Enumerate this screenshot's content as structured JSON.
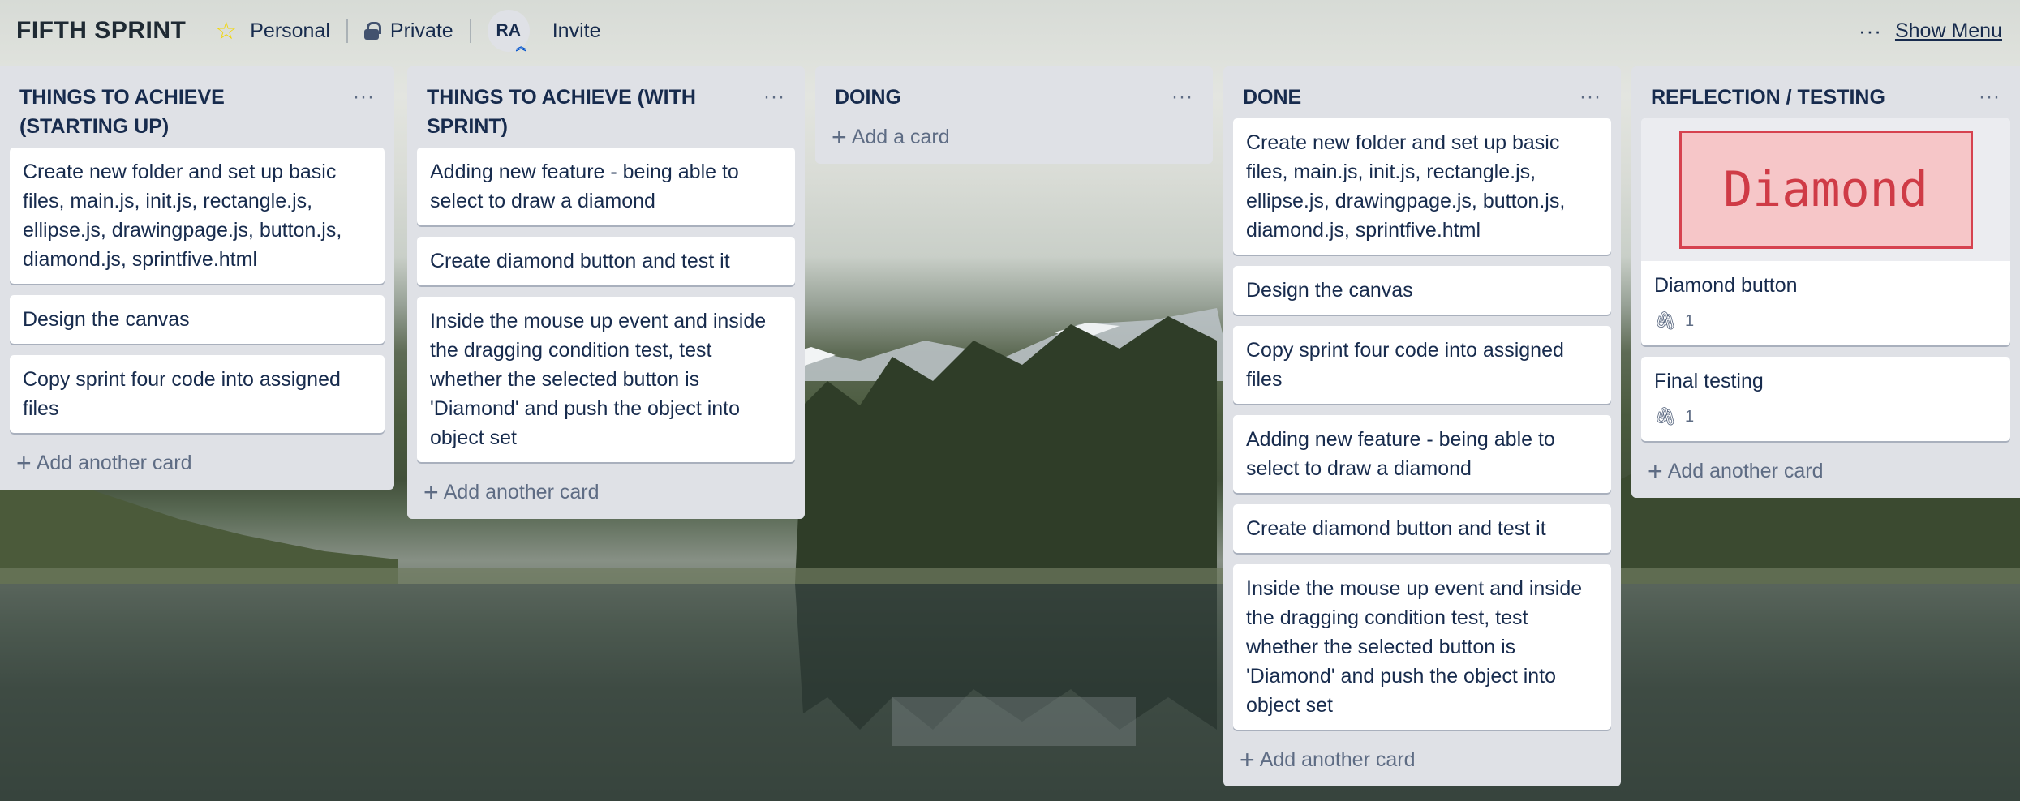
{
  "header": {
    "board_title": "FIFTH SPRINT",
    "visibility_team": "Personal",
    "visibility_privacy": "Private",
    "avatar_initials": "RA",
    "invite_label": "Invite",
    "menu_dots": "···",
    "show_menu_label": "Show Menu"
  },
  "lists": [
    {
      "title": "THINGS TO ACHIEVE (STARTING UP)",
      "cards": [
        "Create new folder and set up basic files, main.js, init.js, rectangle.js, ellipse.js, drawingpage.js, button.js, diamond.js, sprintfive.html",
        "Design the canvas",
        "Copy sprint four code into assigned files"
      ],
      "add_label": "Add another card"
    },
    {
      "title": "THINGS TO ACHIEVE (WITH SPRINT)",
      "cards": [
        "Adding new feature - being able to select to draw a diamond",
        "Create diamond button and test it",
        "Inside the mouse up event and inside the dragging condition test, test whether the selected button is 'Diamond' and push the object into object set"
      ],
      "add_label": "Add another card"
    },
    {
      "title": "DOING",
      "cards": [],
      "add_label": "Add a card"
    },
    {
      "title": "DONE",
      "cards": [
        "Create new folder and set up basic files, main.js, init.js, rectangle.js, ellipse.js, drawingpage.js, button.js, diamond.js, sprintfive.html",
        "Design the canvas",
        "Copy sprint four code into assigned files",
        "Adding new feature - being able to select to draw a diamond",
        "Create diamond button and test it",
        "Inside the mouse up event and inside the dragging condition test, test whether the selected button is 'Diamond' and push the object into object set"
      ],
      "add_label": "Add another card"
    },
    {
      "title": "REFLECTION / TESTING",
      "cards": [
        {
          "cover_text": "Diamond",
          "title": "Diamond button",
          "attachments": "1"
        },
        {
          "title": "Final testing",
          "attachments": "1"
        }
      ],
      "add_label": "Add another card"
    }
  ],
  "list_menu_glyph": "···",
  "add_glyph": "+",
  "colors": {
    "list_bg": "#dfe1e6",
    "card_bg": "#ffffff",
    "text": "#172b4d",
    "muted": "#5e6c84",
    "star": "#f2d600",
    "cover_fill": "#f6c6c8",
    "cover_border": "#d6424f"
  }
}
